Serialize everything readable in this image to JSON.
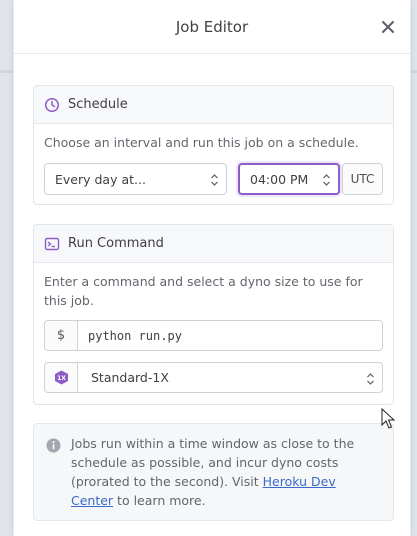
{
  "modal": {
    "title": "Job Editor",
    "close_icon": "close-icon"
  },
  "schedule": {
    "heading": "Schedule",
    "icon": "clock-icon",
    "description": "Choose an interval and run this job on a schedule.",
    "interval_value": "Every day at...",
    "time_value": "04:00 PM",
    "timezone": "UTC"
  },
  "run_command": {
    "heading": "Run Command",
    "icon": "terminal-icon",
    "description": "Enter a command and select a dyno size to use for this job.",
    "prefix": "$",
    "command_value": "python run.py",
    "dyno_badge": "1X",
    "dyno_size": "Standard-1X"
  },
  "info": {
    "icon": "info-icon",
    "text_before": "Jobs run within a time window as close to the schedule as possible, and incur dyno costs (prorated to the second). Visit ",
    "link_text": "Heroku Dev Center",
    "text_after": " to learn more."
  },
  "colors": {
    "accent_purple": "#8e5cc7",
    "link_blue": "#3a69c7"
  }
}
